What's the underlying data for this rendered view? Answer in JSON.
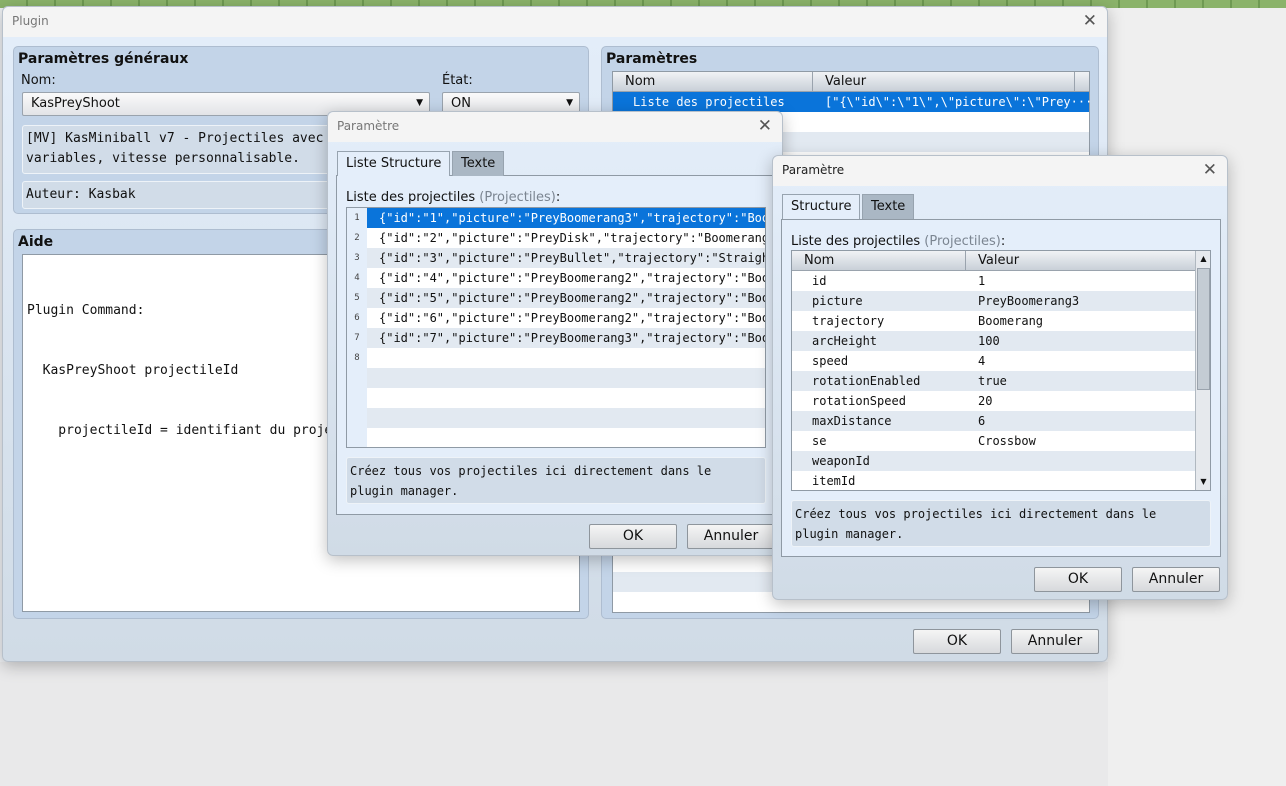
{
  "main_window": {
    "title": "Plugin",
    "general": {
      "title": "Paramètres généraux",
      "name_label": "Nom:",
      "name_value": "KasPreyShoot",
      "state_label": "État:",
      "state_value": "ON",
      "description": [
        "[MV] KasMiniball v7 - Projectiles avec distar",
        "variables, vitesse personnalisable."
      ],
      "author": "Auteur: Kasbak"
    },
    "help": {
      "title": "Aide",
      "lines": [
        "Plugin Command:",
        "  KasPreyShoot projectileId",
        "    projectileId = identifiant du projectile"
      ]
    },
    "params": {
      "title": "Paramètres",
      "col_name": "Nom",
      "col_value": "Valeur",
      "rows": [
        {
          "name": "Liste des projectiles",
          "value": "[\"{\\\"id\\\":\\\"1\\\",\\\"picture\\\":\\\"Prey···"
        }
      ]
    },
    "ok": "OK",
    "cancel": "Annuler"
  },
  "dialog_list": {
    "title": "Paramètre",
    "tabs": [
      "Liste Structure",
      "Texte"
    ],
    "label": "Liste des projectiles",
    "label_type": "(Projectiles)",
    "items": [
      {
        "n": "1",
        "text": "{\"id\":\"1\",\"picture\":\"PreyBoomerang3\",\"trajectory\":\"Boo···"
      },
      {
        "n": "2",
        "text": "{\"id\":\"2\",\"picture\":\"PreyDisk\",\"trajectory\":\"Boomerang···"
      },
      {
        "n": "3",
        "text": "{\"id\":\"3\",\"picture\":\"PreyBullet\",\"trajectory\":\"Straigh···"
      },
      {
        "n": "4",
        "text": "{\"id\":\"4\",\"picture\":\"PreyBoomerang2\",\"trajectory\":\"Boo···"
      },
      {
        "n": "5",
        "text": "{\"id\":\"5\",\"picture\":\"PreyBoomerang2\",\"trajectory\":\"Boo···"
      },
      {
        "n": "6",
        "text": "{\"id\":\"6\",\"picture\":\"PreyBoomerang2\",\"trajectory\":\"Boo···"
      },
      {
        "n": "7",
        "text": "{\"id\":\"7\",\"picture\":\"PreyBoomerang3\",\"trajectory\":\"Boo···"
      },
      {
        "n": "8",
        "text": ""
      }
    ],
    "note": "Créez tous vos projectiles ici directement dans le plugin manager.",
    "ok": "OK",
    "cancel": "Annuler"
  },
  "dialog_struct": {
    "title": "Paramètre",
    "tabs": [
      "Structure",
      "Texte"
    ],
    "label": "Liste des projectiles",
    "label_type": "(Projectiles)",
    "col_name": "Nom",
    "col_value": "Valeur",
    "rows": [
      {
        "name": "id",
        "value": "1"
      },
      {
        "name": "picture",
        "value": "PreyBoomerang3"
      },
      {
        "name": "trajectory",
        "value": "Boomerang"
      },
      {
        "name": "arcHeight",
        "value": "100"
      },
      {
        "name": "speed",
        "value": "4"
      },
      {
        "name": "rotationEnabled",
        "value": "true"
      },
      {
        "name": "rotationSpeed",
        "value": "20"
      },
      {
        "name": "maxDistance",
        "value": "6"
      },
      {
        "name": "se",
        "value": "Crossbow"
      },
      {
        "name": "weaponId",
        "value": ""
      },
      {
        "name": "itemId",
        "value": ""
      }
    ],
    "note": "Créez tous vos projectiles ici directement dans le plugin manager.",
    "ok": "OK",
    "cancel": "Annuler"
  },
  "colors": {
    "selection": "#0a74da",
    "group_header": "#c3d4e8"
  }
}
